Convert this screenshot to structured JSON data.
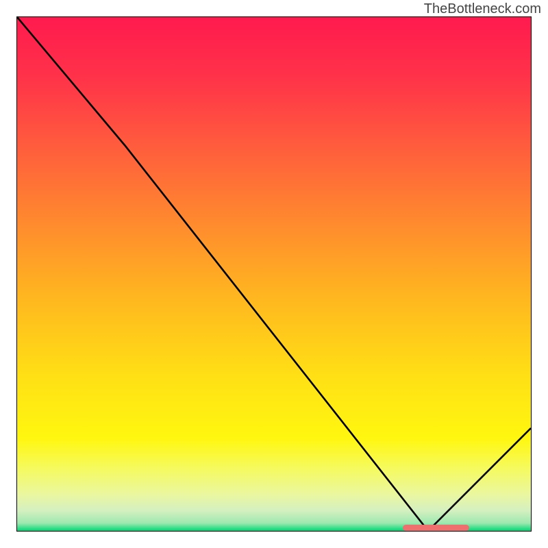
{
  "attribution": "TheBottleneck.com",
  "chart_data": {
    "type": "line",
    "title": "",
    "xlabel": "",
    "ylabel": "",
    "xlim": [
      0,
      100
    ],
    "ylim": [
      0,
      100
    ],
    "x": [
      0,
      21,
      80,
      100
    ],
    "values": [
      100,
      75,
      0,
      20
    ],
    "marker": {
      "x_start": 75,
      "x_end": 88,
      "y": 0
    },
    "gradient_stops": [
      {
        "pos": 0.0,
        "color": "#ff1a4e"
      },
      {
        "pos": 0.12,
        "color": "#ff3349"
      },
      {
        "pos": 0.25,
        "color": "#ff5c3d"
      },
      {
        "pos": 0.4,
        "color": "#ff8a2e"
      },
      {
        "pos": 0.55,
        "color": "#ffb81f"
      },
      {
        "pos": 0.7,
        "color": "#ffe015"
      },
      {
        "pos": 0.82,
        "color": "#fff70f"
      },
      {
        "pos": 0.88,
        "color": "#f5fa60"
      },
      {
        "pos": 0.93,
        "color": "#eaf7a0"
      },
      {
        "pos": 0.96,
        "color": "#d5f0c0"
      },
      {
        "pos": 0.985,
        "color": "#9de8b0"
      },
      {
        "pos": 1.0,
        "color": "#00d775"
      }
    ]
  }
}
